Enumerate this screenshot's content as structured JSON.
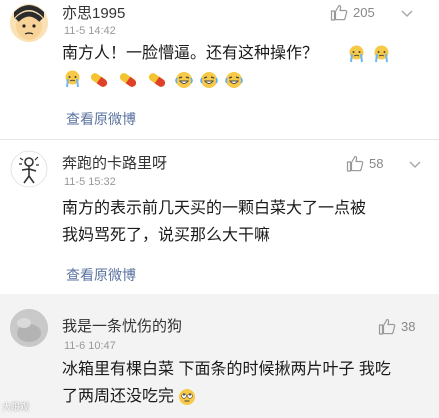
{
  "comments": [
    {
      "username": "亦思1995",
      "timestamp": "11-5 14:42",
      "likes": "205",
      "text": "南方人！一脸懵逼。还有这种操作？",
      "link": "查看原微博",
      "emojis": [
        "crying-emoji",
        "crying-emoji",
        "pill-emoji",
        "pill-emoji",
        "pill-emoji",
        "laughing-crying-emoji",
        "laughing-crying-emoji",
        "laughing-crying-emoji"
      ]
    },
    {
      "username": "奔跑的卡路里呀",
      "timestamp": "11-5 15:32",
      "likes": "58",
      "text_line1": "南方的表示前几天买的一颗白菜大了一点被",
      "text_line2": "我妈骂死了，说买那么大干嘛",
      "link": "查看原微博"
    },
    {
      "username": "我是一条忧伤的狗",
      "timestamp": "11-6 10:47",
      "likes": "38",
      "text_line1": "冰箱里有棵白菜 下面条的时候揪两片叶子 我吃",
      "text_line2": "了两周还没吃完"
    }
  ],
  "watermark": "大眼观",
  "colors": {
    "link": "#5b73a0",
    "meta": "#999999",
    "highlight_bg": "#f3f3f3"
  }
}
